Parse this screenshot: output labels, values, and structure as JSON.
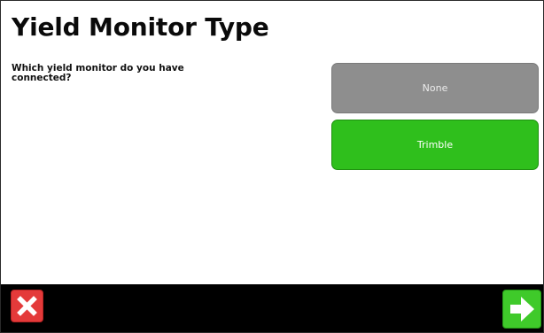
{
  "page": {
    "title": "Yield Monitor Type",
    "prompt": "Which yield monitor do you have connected?"
  },
  "options": [
    {
      "label": "None",
      "selected": false
    },
    {
      "label": "Trimble",
      "selected": true
    }
  ],
  "bottom_bar": {
    "cancel_icon": "close-icon",
    "next_icon": "arrow-right-icon"
  },
  "colors": {
    "selected_option": "#2fbf1c",
    "unselected_option": "#8e8e8e",
    "cancel": "#e43a3a",
    "next": "#3fca2a"
  }
}
